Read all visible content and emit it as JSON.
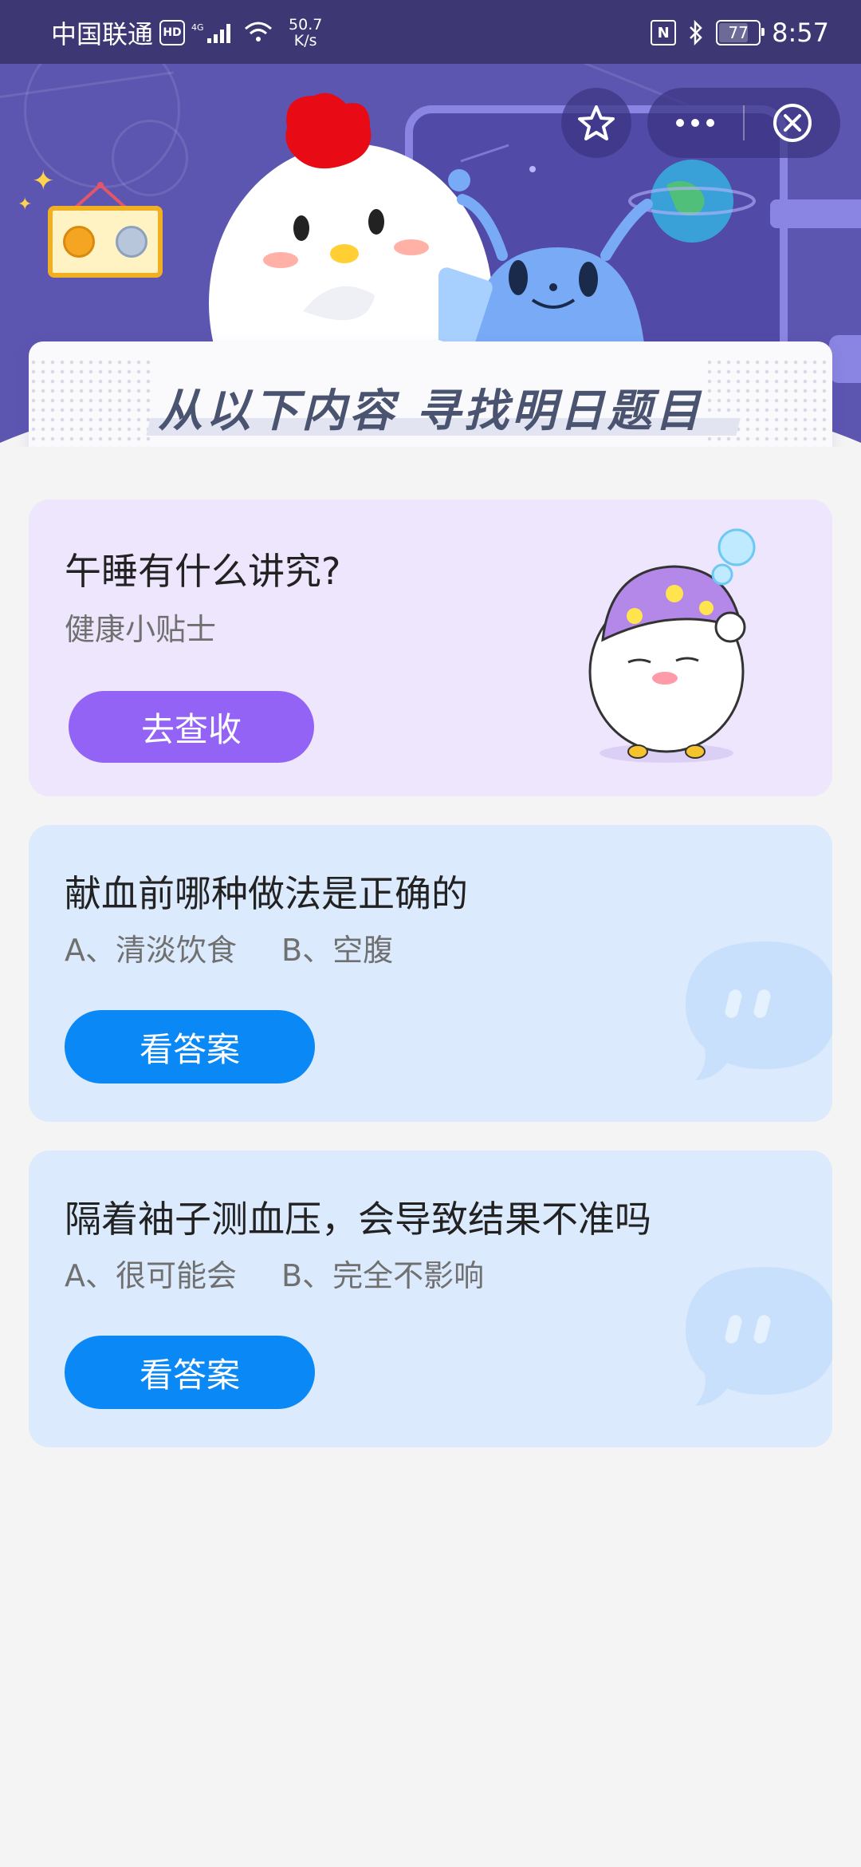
{
  "status_bar": {
    "carrier": "中国联通",
    "hd": "HD",
    "network": "4G",
    "speed_value": "50.7",
    "speed_unit": "K/s",
    "nfc": "N",
    "battery": "77",
    "battery_level": 0.77,
    "time": "8:57"
  },
  "capsule": {
    "star_icon": "star-icon",
    "more_icon": "more-dots-icon",
    "close_icon": "close-circle-icon"
  },
  "banner": {
    "title": "从以下内容  寻找明日题目"
  },
  "cards": {
    "tip": {
      "title": "午睡有什么讲究?",
      "subtitle": "健康小贴士",
      "button": "去查收"
    },
    "q1": {
      "title": "献血前哪种做法是正确的",
      "option_a": "A、清淡饮食",
      "option_b": "B、空腹",
      "button": "看答案"
    },
    "q2": {
      "title": "隔着袖子测血压，会导致结果不准吗",
      "option_a": "A、很可能会",
      "option_b": "B、完全不影响",
      "button": "看答案"
    }
  },
  "colors": {
    "header_bg": "#5d56b1",
    "status_bar_bg": "#3d3874",
    "purple_card_bg": "#eee6fd",
    "purple_button": "#9263f4",
    "blue_card_bg": "#dbeafc",
    "blue_button": "#0a88f5",
    "page_bg": "#f4f4f5"
  }
}
